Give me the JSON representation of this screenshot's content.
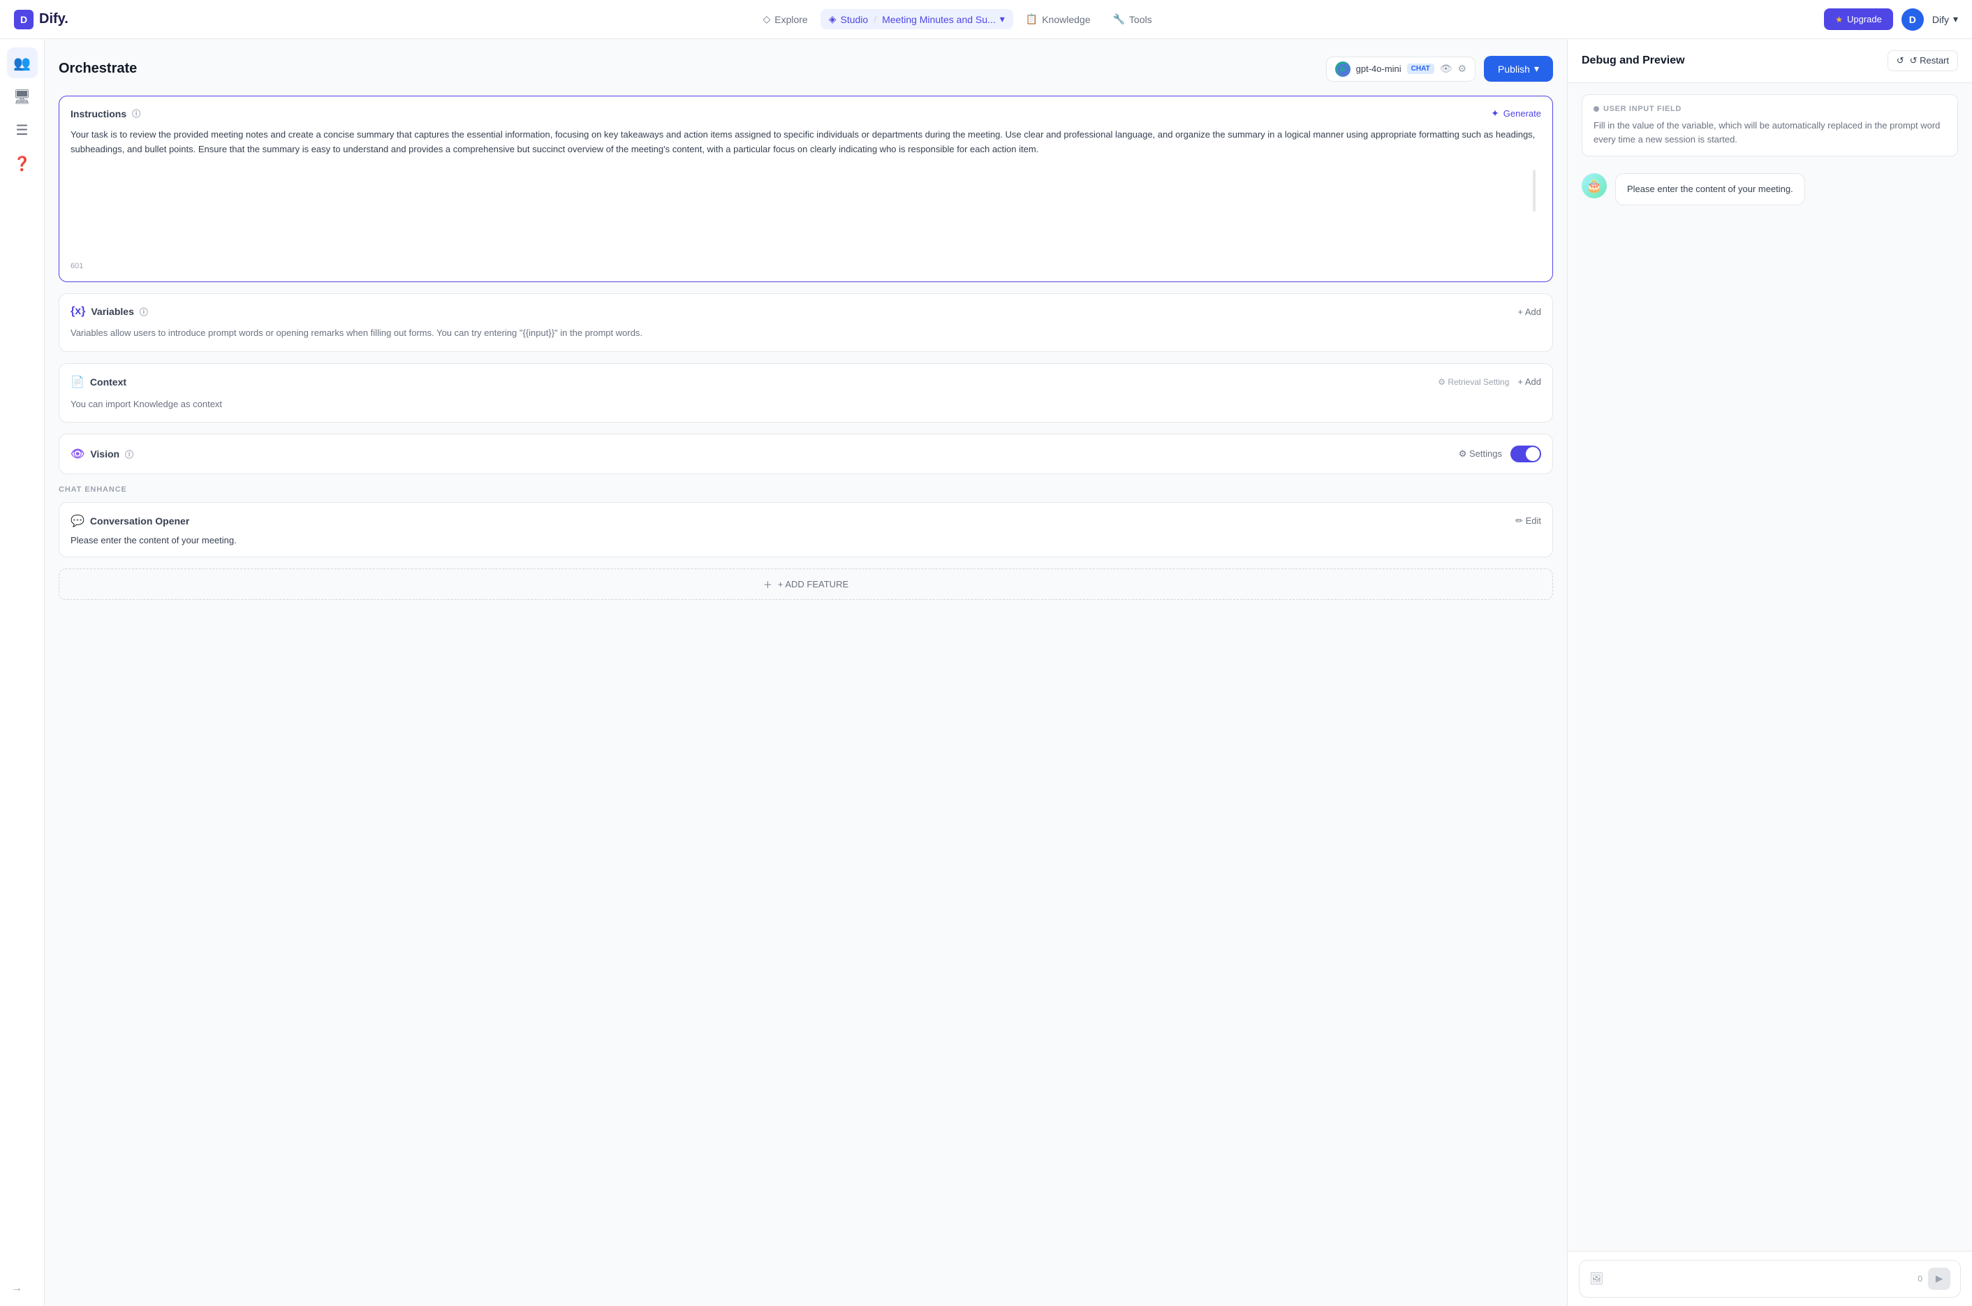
{
  "topnav": {
    "logo_letter": "D",
    "logo_text": "Dify.",
    "explore_label": "Explore",
    "studio_label": "Studio",
    "separator": "/",
    "project_name": "Meeting Minutes and Su...",
    "dropdown_icon": "▾",
    "knowledge_label": "Knowledge",
    "tools_label": "Tools",
    "upgrade_label": "Upgrade",
    "user_initial": "D",
    "user_name": "Dify",
    "user_dropdown": "▾"
  },
  "sidebar": {
    "icons": [
      {
        "name": "people-icon",
        "glyph": "👥",
        "active": true
      },
      {
        "name": "monitor-icon",
        "glyph": "🖥",
        "active": false
      },
      {
        "name": "list-icon",
        "glyph": "☰",
        "active": false
      },
      {
        "name": "help-icon",
        "glyph": "❓",
        "active": false
      }
    ],
    "expand_icon": "→"
  },
  "orchestrate": {
    "title": "Orchestrate",
    "model": {
      "name": "gpt-4o-mini",
      "badge": "CHAT",
      "eye_icon": "👁",
      "settings_icon": "⚙"
    },
    "publish_label": "Publish"
  },
  "instructions": {
    "section_title": "Instructions",
    "generate_label": "Generate",
    "text": "Your task is to review the provided meeting notes and create a concise summary that captures the essential information, focusing on key takeaways and action items assigned to specific individuals or departments during the meeting. Use clear and professional language, and organize the summary in a logical manner using appropriate formatting such as headings, subheadings, and bullet points. Ensure that the summary is easy to understand and provides a comprehensive but succinct overview of the meeting's content, with a particular focus on clearly indicating who is responsible for each action item.",
    "char_count": "601"
  },
  "variables": {
    "section_title": "Variables",
    "add_label": "+ Add",
    "description": "Variables allow users to introduce prompt words or opening remarks when filling out forms. You can try entering \"{{input}}\" in the prompt words."
  },
  "context": {
    "section_title": "Context",
    "retrieval_label": "⚙ Retrieval Setting",
    "add_label": "+ Add",
    "description": "You can import Knowledge as context"
  },
  "vision": {
    "section_title": "Vision",
    "settings_label": "⚙ Settings",
    "enabled": true
  },
  "chat_enhance": {
    "section_label": "CHAT ENHANCE",
    "conversation_opener": {
      "title": "Conversation Opener",
      "edit_label": "✏ Edit",
      "text": "Please enter the content of your meeting."
    },
    "add_feature_label": "+ ADD FEATURE"
  },
  "debug": {
    "title": "Debug and Preview",
    "restart_label": "↺ Restart",
    "user_input_field": {
      "header": "USER INPUT FIELD",
      "description": "Fill in the value of the variable, which will be automatically replaced in the prompt word every time a new session is started."
    },
    "chat_message": {
      "avatar_emoji": "🎂",
      "text": "Please enter the content of your meeting."
    },
    "input_placeholder": "",
    "char_count": "0"
  }
}
